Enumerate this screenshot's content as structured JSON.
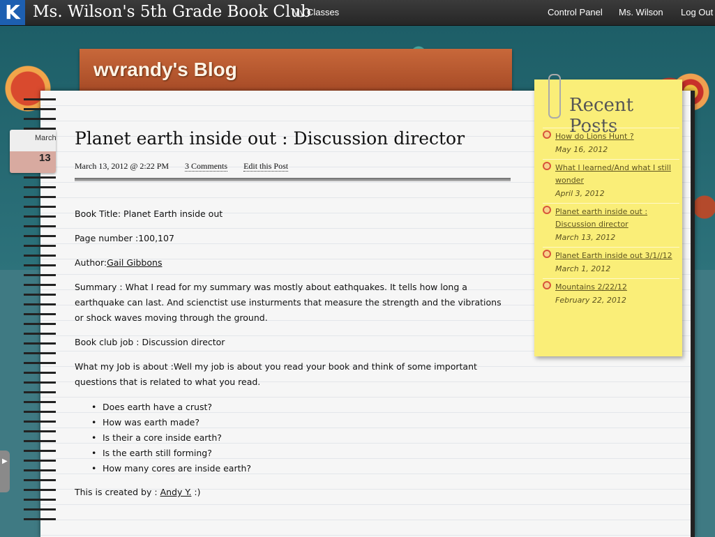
{
  "topbar": {
    "site_title": "Ms. Wilson's 5th Grade Book Club",
    "logo_letter": "K",
    "nav": {
      "my_classes": "My Classes",
      "control_panel": "Control Panel",
      "user": "Ms. Wilson",
      "logout": "Log Out"
    }
  },
  "blog": {
    "title": "wvrandy's Blog"
  },
  "date_tab": {
    "month": "March",
    "day": "13"
  },
  "post": {
    "title": "Planet earth inside out : Discussion director",
    "date": "March 13, 2012 @ 2:22 PM",
    "comments": "3 Comments",
    "edit": "Edit this Post",
    "book_title": "Book Title: Planet Earth inside out",
    "page_number": "Page number :100,107",
    "author_label": "Author:",
    "author_name": "Gail Gibbons",
    "summary": "Summary : What I read for my summary was mostly about eathquakes. It tells how long a earthquake can last. And scienctist use  insturments that measure the strength and the vibrations or shock waves moving through the ground.",
    "job": "Book club job : Discussion director",
    "job_about": "What my Job is about :Well my job is about you read your book and think of some important questions that is related to what you read.",
    "questions": [
      "Does earth have a crust?",
      "How was earth made?",
      "Is their a core inside earth?",
      "Is the earth still forming?",
      "How many cores are inside earth?"
    ],
    "created_prefix": "This is created by : ",
    "created_by": "Andy Y.",
    "created_suffix": " :)"
  },
  "recent_posts": {
    "title": "Recent Posts",
    "items": [
      {
        "title": "How do Lions Hunt ?",
        "date": "May 16, 2012"
      },
      {
        "title": "What I learned/And what I still wonder",
        "date": "April 3, 2012"
      },
      {
        "title": "Planet earth inside out : Discussion director",
        "date": "March 13, 2012"
      },
      {
        "title": "Planet Earth inside out 3/1//12",
        "date": "March 1, 2012"
      },
      {
        "title": "Mountains 2/22/12",
        "date": "February 22, 2012"
      }
    ]
  }
}
